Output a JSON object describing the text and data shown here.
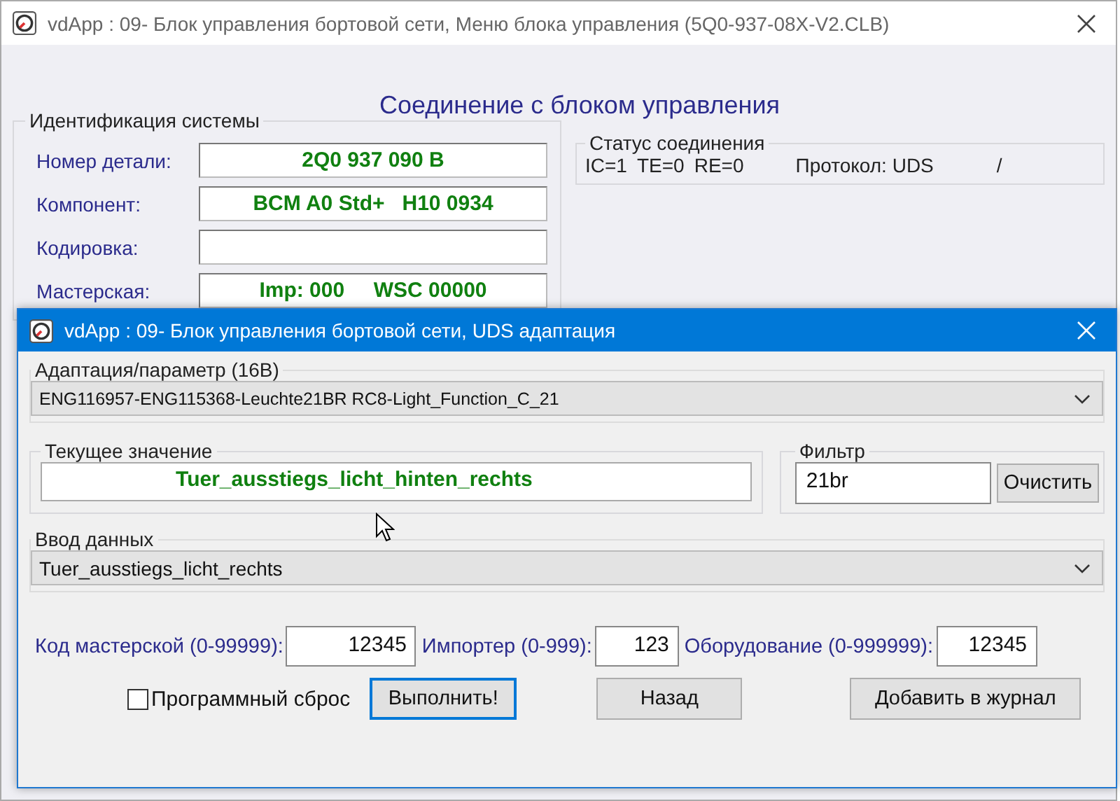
{
  "main_window": {
    "title": "vdApp : 09- Блок управления бортовой сети,  Меню блока управления (5Q0-937-08X-V2.CLB)",
    "heading": "Соединение с блоком управления",
    "identification": {
      "title": "Идентификация системы",
      "rows": [
        {
          "label": "Номер детали:",
          "value": "2Q0 937 090 B"
        },
        {
          "label": "Компонент:",
          "value": "BCM A0 Std+   H10 0934"
        },
        {
          "label": "Кодировка:",
          "value": ""
        },
        {
          "label": "Мастерская:",
          "value": "Imp: 000     WSC 00000"
        }
      ]
    },
    "connection_status": {
      "title": "Статус соединения",
      "items": [
        "IC=1",
        "TE=0",
        "RE=0",
        "Протокол: UDS",
        "/"
      ]
    }
  },
  "dialog": {
    "title": "vdApp : 09- Блок управления бортовой сети,  UDS адаптация",
    "adaptation": {
      "title": "Адаптация/параметр (16В)",
      "value": "ENG116957-ENG115368-Leuchte21BR RC8-Light_Function_C_21"
    },
    "current_value": {
      "title": "Текущее значение",
      "value": "Tuer_ausstiegs_licht_hinten_rechts"
    },
    "filter": {
      "title": "Фильтр",
      "value": "21br",
      "button": "Очистить"
    },
    "data_input": {
      "title": "Ввод данных",
      "value": "Tuer_ausstiegs_licht_rechts"
    },
    "codes": [
      {
        "label": "Код мастерской (0-99999):",
        "value": "12345"
      },
      {
        "label": "Импортер (0-999):",
        "value": "123"
      },
      {
        "label": "Оборудование (0-999999):",
        "value": "12345"
      }
    ],
    "program_reset": {
      "label": "Программный сброс",
      "checked": false
    },
    "buttons": [
      {
        "label": "Выполнить!",
        "selected": true
      },
      {
        "label": "Назад",
        "selected": false
      },
      {
        "label": "Добавить в журнал",
        "selected": false
      }
    ]
  }
}
